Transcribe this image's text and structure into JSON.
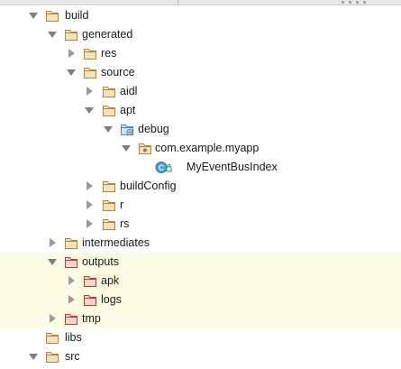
{
  "tree": {
    "build": "build",
    "generated": "generated",
    "res": "res",
    "source": "source",
    "aidl": "aidl",
    "apt": "apt",
    "debug": "debug",
    "package": "com.example.myapp",
    "class_badge": "C",
    "class_file": "MyEventBusIndex",
    "buildConfig": "buildConfig",
    "r": "r",
    "rs": "rs",
    "intermediates": "intermediates",
    "outputs": "outputs",
    "apk": "apk",
    "logs": "logs",
    "tmp": "tmp",
    "libs": "libs",
    "src": "src"
  },
  "colors": {
    "folder_fill": "#f2e3c0",
    "folder_stroke": "#b8862f",
    "excluded_fill": "#f6d4d0",
    "excluded_stroke": "#c0392b",
    "source_root_fill": "#cfe2f6",
    "source_root_stroke": "#4a86c5",
    "highlight_row": "#fcfce5",
    "class_badge": "#3f9fdc"
  }
}
